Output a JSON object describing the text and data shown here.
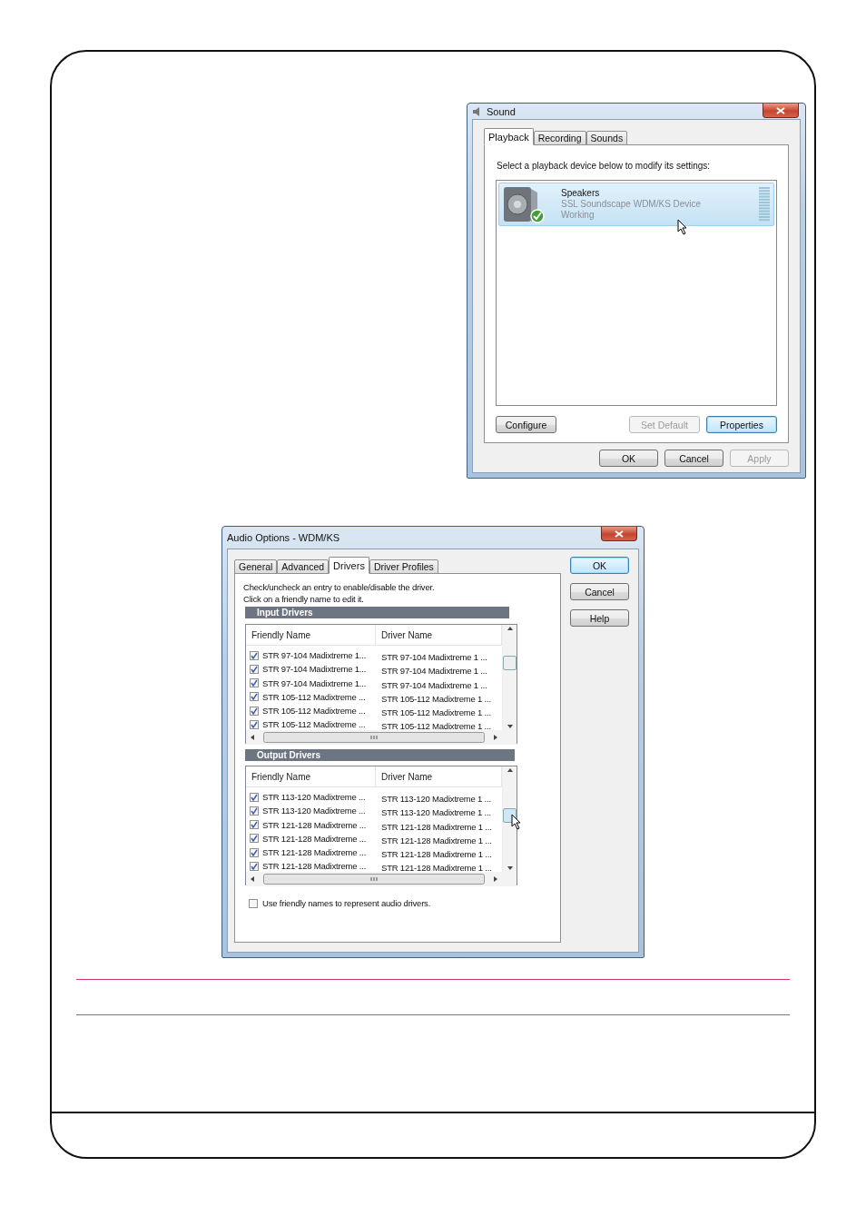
{
  "sound_window": {
    "title": "Sound",
    "tabs": [
      {
        "label": "Playback",
        "selected": true
      },
      {
        "label": "Recording",
        "selected": false
      },
      {
        "label": "Sounds",
        "selected": false
      }
    ],
    "instruction": "Select a playback device below to modify its settings:",
    "devices": [
      {
        "name": "Speakers",
        "description": "SSL Soundscape WDM/KS Device",
        "status": "Working",
        "selected": true
      }
    ],
    "buttons": [
      {
        "label": "Configure",
        "disabled": false,
        "focused": false
      },
      {
        "label": "Set Default",
        "disabled": true,
        "focused": false
      },
      {
        "label": "Properties",
        "disabled": false,
        "focused": true
      }
    ],
    "footer_buttons": [
      {
        "label": "OK",
        "disabled": false
      },
      {
        "label": "Cancel",
        "disabled": false
      },
      {
        "label": "Apply",
        "disabled": true
      }
    ]
  },
  "audio_options_window": {
    "title": "Audio Options - WDM/KS",
    "tabs": [
      {
        "label": "General",
        "selected": false
      },
      {
        "label": "Advanced",
        "selected": false
      },
      {
        "label": "Drivers",
        "selected": true
      },
      {
        "label": "Driver Profiles",
        "selected": false
      }
    ],
    "instructions": [
      "Check/uncheck an entry to enable/disable the driver.",
      "Click on a friendly name to edit it."
    ],
    "sections": [
      {
        "title": "Input Drivers",
        "columns": [
          "Friendly Name",
          "Driver Name"
        ],
        "rows": [
          {
            "checked": true,
            "friendly_name": "STR 97-104 Madixtreme 1...",
            "driver_name": "STR 97-104 Madixtreme 1 ..."
          },
          {
            "checked": true,
            "friendly_name": "STR 97-104 Madixtreme 1...",
            "driver_name": "STR 97-104 Madixtreme 1 ..."
          },
          {
            "checked": true,
            "friendly_name": "STR 97-104 Madixtreme 1...",
            "driver_name": "STR 97-104 Madixtreme 1 ..."
          },
          {
            "checked": true,
            "friendly_name": "STR 105-112 Madixtreme ...",
            "driver_name": "STR 105-112 Madixtreme 1 ..."
          },
          {
            "checked": true,
            "friendly_name": "STR 105-112 Madixtreme ...",
            "driver_name": "STR 105-112 Madixtreme 1 ..."
          },
          {
            "checked": true,
            "friendly_name": "STR 105-112 Madixtreme ...",
            "driver_name": "STR 105-112 Madixtreme 1 ..."
          }
        ]
      },
      {
        "title": "Output Drivers",
        "columns": [
          "Friendly Name",
          "Driver Name"
        ],
        "rows": [
          {
            "checked": true,
            "friendly_name": "STR 113-120 Madixtreme ...",
            "driver_name": "STR 113-120 Madixtreme 1 ..."
          },
          {
            "checked": true,
            "friendly_name": "STR 113-120 Madixtreme ...",
            "driver_name": "STR 113-120 Madixtreme 1 ..."
          },
          {
            "checked": true,
            "friendly_name": "STR 121-128 Madixtreme ...",
            "driver_name": "STR 121-128 Madixtreme 1 ..."
          },
          {
            "checked": true,
            "friendly_name": "STR 121-128 Madixtreme ...",
            "driver_name": "STR 121-128 Madixtreme 1 ..."
          },
          {
            "checked": true,
            "friendly_name": "STR 121-128 Madixtreme ...",
            "driver_name": "STR 121-128 Madixtreme 1 ..."
          },
          {
            "checked": true,
            "friendly_name": "STR 121-128 Madixtreme ...",
            "driver_name": "STR 121-128 Madixtreme 1 ..."
          }
        ]
      }
    ],
    "option": {
      "label": "Use friendly names to represent audio drivers.",
      "checked": false
    },
    "buttons": [
      {
        "label": "OK",
        "focused": true
      },
      {
        "label": "Cancel",
        "focused": false
      },
      {
        "label": "Help",
        "focused": false
      }
    ]
  }
}
